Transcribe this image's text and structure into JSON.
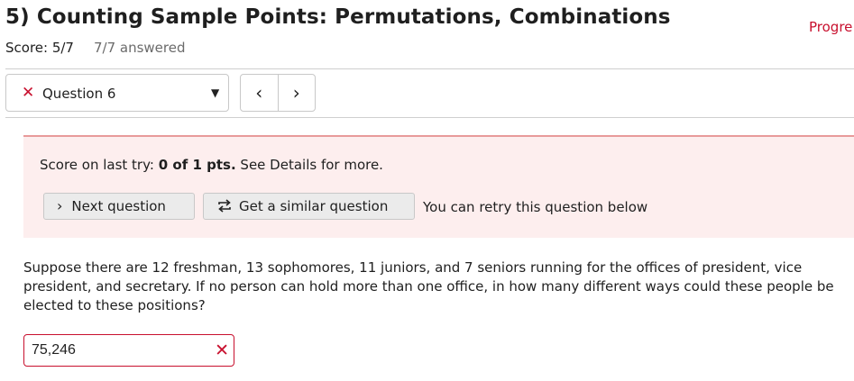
{
  "header": {
    "title": "5) Counting Sample Points: Permutations, Combinations",
    "progress_label": "Progre",
    "score_text": "Score: 5/7",
    "answered_text": "7/7 answered"
  },
  "question_nav": {
    "status_icon": "x-mark-icon",
    "selected_question": "Question 6",
    "prev_label": "‹",
    "next_label": "›"
  },
  "feedback": {
    "score_prefix": "Score on last try:",
    "score_value": "0 of 1 pts.",
    "score_suffix": "See Details for more.",
    "next_question_label": "Next question",
    "similar_question_label": "Get a similar question",
    "retry_note": "You can retry this question below"
  },
  "question": {
    "text": "Suppose there are 12 freshman, 13 sophomores, 11 juniors, and 7 seniors running for the offices of president, vice president, and secretary. If no person can hold more than one office, in how many different ways could these people be elected to these positions?"
  },
  "answer": {
    "value": "75,246",
    "status": "incorrect"
  },
  "colors": {
    "error_red": "#c8102e",
    "feedback_bg": "#fdeeee"
  }
}
